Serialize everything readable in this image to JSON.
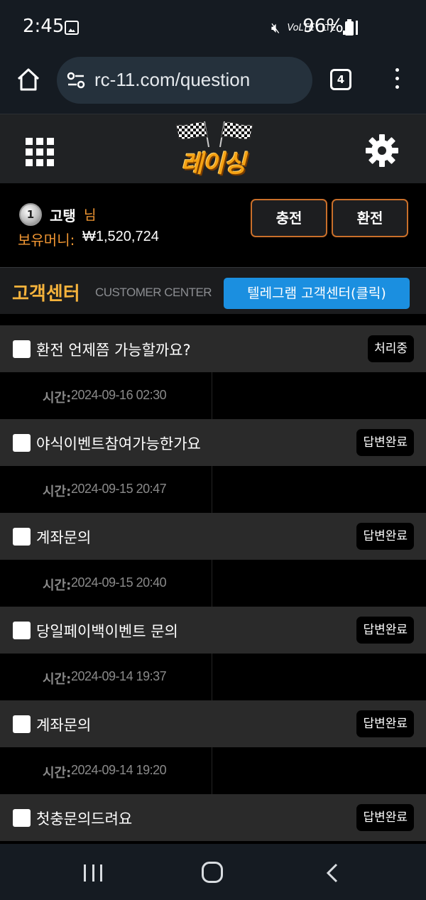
{
  "status_bar": {
    "time": "2:45",
    "network": "VoLTE",
    "lte": "LTE",
    "battery": "96%"
  },
  "browser": {
    "url": "rc-11.com/question",
    "tab_count": "4"
  },
  "site": {
    "logo_text": "레이싱",
    "accent_color": "#f29733"
  },
  "user": {
    "level": "1",
    "name": "고탱",
    "name_suffix": "님",
    "balance_label": "보유머니:",
    "balance_value": "₩1,520,724",
    "charge_label": "충전",
    "withdraw_label": "환전"
  },
  "customer_center": {
    "title": "고객센터",
    "subtitle": "CUSTOMER CENTER",
    "telegram_label": "텔레그램 고객센터(클릭)"
  },
  "time_label": "시간:",
  "questions": [
    {
      "title": "환전 언제쯤 가능할까요?",
      "status": "처리중",
      "time": "2024-09-16 02:30"
    },
    {
      "title": "야식이벤트참여가능한가요",
      "status": "답변완료",
      "time": "2024-09-15 20:47"
    },
    {
      "title": "계좌문의",
      "status": "답변완료",
      "time": "2024-09-15 20:40"
    },
    {
      "title": "당일페이백이벤트 문의",
      "status": "답변완료",
      "time": "2024-09-14 19:37"
    },
    {
      "title": "계좌문의",
      "status": "답변완료",
      "time": "2024-09-14 19:20"
    },
    {
      "title": "첫충문의드려요",
      "status": "답변완료",
      "time": ""
    }
  ]
}
